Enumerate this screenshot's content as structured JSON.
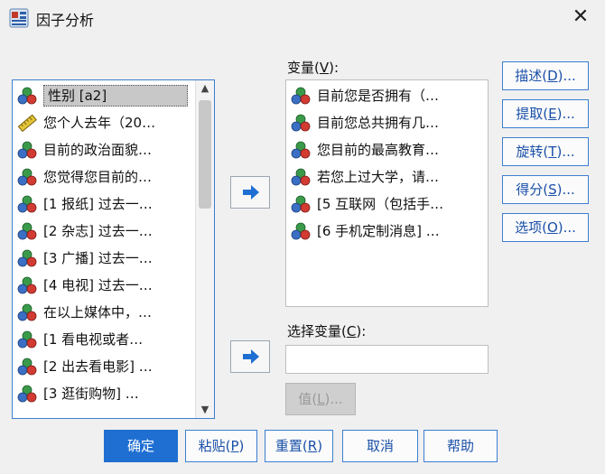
{
  "window": {
    "title": "因子分析",
    "close_glyph": "✕"
  },
  "source_list": {
    "items": [
      {
        "label": "性别 [a2]",
        "icon": "nominal-variable-icon",
        "selected": true
      },
      {
        "label": "您个人去年（20…",
        "icon": "scale-variable-icon"
      },
      {
        "label": "目前的政治面貌…",
        "icon": "nominal-variable-icon"
      },
      {
        "label": "您觉得您目前的…",
        "icon": "nominal-variable-icon"
      },
      {
        "label": "[1 报纸]  过去一…",
        "icon": "nominal-variable-icon"
      },
      {
        "label": "[2 杂志]  过去一…",
        "icon": "nominal-variable-icon"
      },
      {
        "label": "[3 广播]  过去一…",
        "icon": "nominal-variable-icon"
      },
      {
        "label": "[4 电视]  过去一…",
        "icon": "nominal-variable-icon"
      },
      {
        "label": "在以上媒体中，…",
        "icon": "nominal-variable-icon"
      },
      {
        "label": "[1  看电视或者…",
        "icon": "nominal-variable-icon"
      },
      {
        "label": "[2  出去看电影] …",
        "icon": "nominal-variable-icon"
      },
      {
        "label": "[3  逛街购物]  …",
        "icon": "nominal-variable-icon"
      }
    ]
  },
  "variables": {
    "label": "变量",
    "mnemonic": "V",
    "items": [
      {
        "label": "目前您是否拥有（…",
        "icon": "nominal-variable-icon"
      },
      {
        "label": "目前您总共拥有几…",
        "icon": "nominal-variable-icon"
      },
      {
        "label": "您目前的最高教育…",
        "icon": "nominal-variable-icon"
      },
      {
        "label": "若您上过大学，请…",
        "icon": "nominal-variable-icon"
      },
      {
        "label": "[5 互联网（包括手…",
        "icon": "nominal-variable-icon"
      },
      {
        "label": "[6 手机定制消息]  …",
        "icon": "nominal-variable-icon"
      }
    ]
  },
  "selection_variable": {
    "label": "选择变量",
    "mnemonic": "C",
    "value": ""
  },
  "value_button": {
    "label": "值",
    "mnemonic": "L",
    "suffix": "..."
  },
  "side_buttons": [
    {
      "text": "描述",
      "mnemonic": "D",
      "suffix": "..."
    },
    {
      "text": "提取",
      "mnemonic": "E",
      "suffix": "..."
    },
    {
      "text": "旋转",
      "mnemonic": "T",
      "suffix": "..."
    },
    {
      "text": "得分",
      "mnemonic": "S",
      "suffix": "..."
    },
    {
      "text": "选项",
      "mnemonic": "O",
      "suffix": "..."
    }
  ],
  "bottom_buttons": {
    "ok": "确定",
    "paste": {
      "text": "粘贴",
      "mnemonic": "P"
    },
    "reset": {
      "text": "重置",
      "mnemonic": "R"
    },
    "cancel": "取消",
    "help": "帮助"
  },
  "colors": {
    "accent": "#1f6fd2",
    "border": "#3c7fd1"
  }
}
